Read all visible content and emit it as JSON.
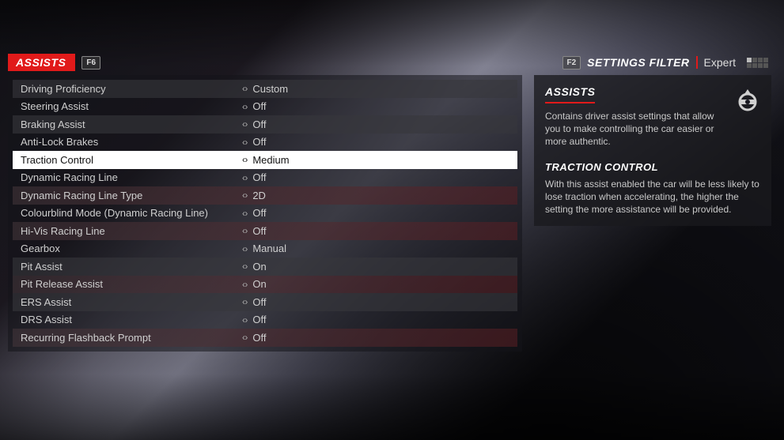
{
  "header": {
    "title": "ASSISTS",
    "title_key": "F6",
    "filter_key": "F2",
    "filter_label": "SETTINGS FILTER",
    "filter_value": "Expert"
  },
  "settings": [
    {
      "label": "Driving Proficiency",
      "value": "Custom",
      "style": "alt",
      "selected": false
    },
    {
      "label": "Steering Assist",
      "value": "Off",
      "style": "plain",
      "selected": false
    },
    {
      "label": "Braking Assist",
      "value": "Off",
      "style": "alt",
      "selected": false
    },
    {
      "label": "Anti-Lock Brakes",
      "value": "Off",
      "style": "plain",
      "selected": false
    },
    {
      "label": "Traction Control",
      "value": "Medium",
      "style": "plain",
      "selected": true
    },
    {
      "label": "Dynamic Racing Line",
      "value": "Off",
      "style": "plain",
      "selected": false
    },
    {
      "label": "Dynamic Racing Line Type",
      "value": "2D",
      "style": "tint",
      "selected": false
    },
    {
      "label": "Colourblind Mode (Dynamic Racing Line)",
      "value": "Off",
      "style": "plain",
      "selected": false
    },
    {
      "label": "Hi-Vis Racing Line",
      "value": "Off",
      "style": "tint",
      "selected": false
    },
    {
      "label": "Gearbox",
      "value": "Manual",
      "style": "plain",
      "selected": false
    },
    {
      "label": "Pit Assist",
      "value": "On",
      "style": "alt",
      "selected": false
    },
    {
      "label": "Pit Release Assist",
      "value": "On",
      "style": "tint",
      "selected": false
    },
    {
      "label": "ERS Assist",
      "value": "Off",
      "style": "alt",
      "selected": false
    },
    {
      "label": "DRS Assist",
      "value": "Off",
      "style": "plain",
      "selected": false
    },
    {
      "label": "Recurring Flashback Prompt",
      "value": "Off",
      "style": "tint",
      "selected": false
    }
  ],
  "info": {
    "title": "ASSISTS",
    "description": "Contains driver assist settings that allow you to make controlling the car easier or more authentic.",
    "subhead": "TRACTION CONTROL",
    "subdesc": "With this assist enabled the car will be less likely to lose traction when accelerating, the higher the setting the more assistance will be provided."
  }
}
